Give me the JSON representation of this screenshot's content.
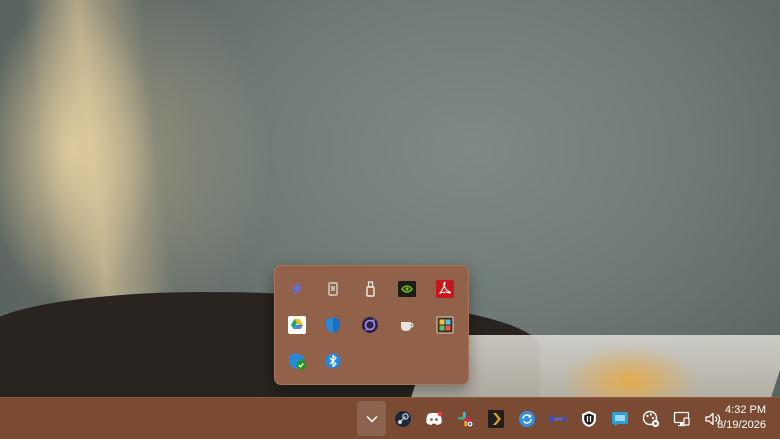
{
  "desktop": {
    "wallpaper": "photo"
  },
  "overflow_flyout": {
    "icons": [
      {
        "name": "power-automate-icon",
        "color": "#5b6cff"
      },
      {
        "name": "device-icon",
        "color": "#c8c0bc"
      },
      {
        "name": "usb-drive-icon",
        "color": "#e8e4e0"
      },
      {
        "name": "nvidia-icon",
        "color": "#76b900"
      },
      {
        "name": "adobe-acrobat-icon",
        "color": "#d7141a"
      },
      {
        "name": "google-drive-icon",
        "color": "#1fa463"
      },
      {
        "name": "windows-security-icon",
        "color": "#2b88d8"
      },
      {
        "name": "sync-app-icon",
        "color": "#3a2f6b"
      },
      {
        "name": "coffee-cup-icon",
        "color": "#e8e4e0"
      },
      {
        "name": "display-settings-icon",
        "color": "#f4c430"
      },
      {
        "name": "defender-shield-check-icon",
        "color": "#2b88d8"
      },
      {
        "name": "bluetooth-icon",
        "color": "#1e88e5"
      }
    ]
  },
  "taskbar": {
    "tray_icons": [
      {
        "name": "chevron-down-icon"
      },
      {
        "name": "steam-icon"
      },
      {
        "name": "discord-icon"
      },
      {
        "name": "slack-icon"
      },
      {
        "name": "plex-icon"
      },
      {
        "name": "sync-circle-icon"
      },
      {
        "name": "link-app-icon"
      },
      {
        "name": "bitdefender-shield-icon"
      },
      {
        "name": "chat-app-icon"
      },
      {
        "name": "color-wheel-settings-icon"
      },
      {
        "name": "network-icon"
      },
      {
        "name": "volume-icon"
      }
    ],
    "clock": {
      "time": "4:32 PM",
      "date": "8/19/2026"
    }
  }
}
